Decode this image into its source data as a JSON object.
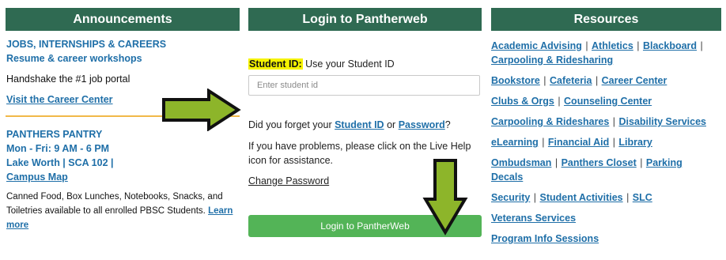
{
  "announcements": {
    "title": "Announcements",
    "jobs_heading": "JOBS, INTERNSHIPS & CAREERS",
    "jobs_sub": "Resume & career workshops",
    "handshake": "Handshake the #1 job portal",
    "visit_link": "Visit the Career Center",
    "pantry_heading": "PANTHERS PANTRY",
    "pantry_hours": "Mon - Fri: 9 AM - 6 PM",
    "pantry_location": "Lake Worth | SCA 102 |",
    "campus_map": "Campus Map",
    "pantry_desc_1": "Canned Food, Box Lunches, Notebooks, Snacks, and",
    "pantry_desc_2": "Toiletries available to all enrolled PBSC Students.",
    "learn": "Learn",
    "more": "more",
    "accent_color": "#f1b949"
  },
  "login": {
    "title": "Login to Pantherweb",
    "student_id_label": "Student ID:",
    "student_id_hint": "Use your Student ID",
    "input_placeholder": "Enter student id",
    "forgot_prefix": "Did you forget your",
    "forgot_student_id": "Student ID",
    "forgot_or": "or",
    "forgot_password": "Password",
    "forgot_suffix": "?",
    "problems_1": "If you have problems, please click on the Live Help",
    "problems_2": "icon for assistance.",
    "change_password": "Change Password",
    "button": "Login to PantherWeb",
    "button_color": "#53b457"
  },
  "resources": {
    "title": "Resources",
    "links": {
      "academic_advising": "Academic Advising",
      "athletics": "Athletics",
      "blackboard": "Blackboard",
      "carpooling_ridesharing": "Carpooling & Ridesharing",
      "bookstore": "Bookstore",
      "cafeteria": "Cafeteria",
      "career_center": "Career Center",
      "clubs_orgs": "Clubs & Orgs",
      "counseling_center": "Counseling Center",
      "carpooling_rideshares": "Carpooling & Rideshares",
      "disability_services": "Disability Services",
      "elearning": "eLearning",
      "financial_aid": "Financial Aid",
      "library": "Library",
      "ombudsman": "Ombudsman",
      "panthers_closet": "Panthers Closet",
      "parking": "Parking",
      "decals": "Decals",
      "security": "Security",
      "student_activities": "Student Activities",
      "slc": "SLC",
      "veterans_services": "Veterans Services",
      "program_info_sessions": "Program Info Sessions"
    },
    "separator": "|"
  },
  "annotations": {
    "arrow_color": "#8db52a",
    "arrow_outline": "#111111"
  },
  "theme": {
    "header_bg": "#2f6a52",
    "link_color": "#1f6fa8",
    "highlight": "#f6f300"
  }
}
